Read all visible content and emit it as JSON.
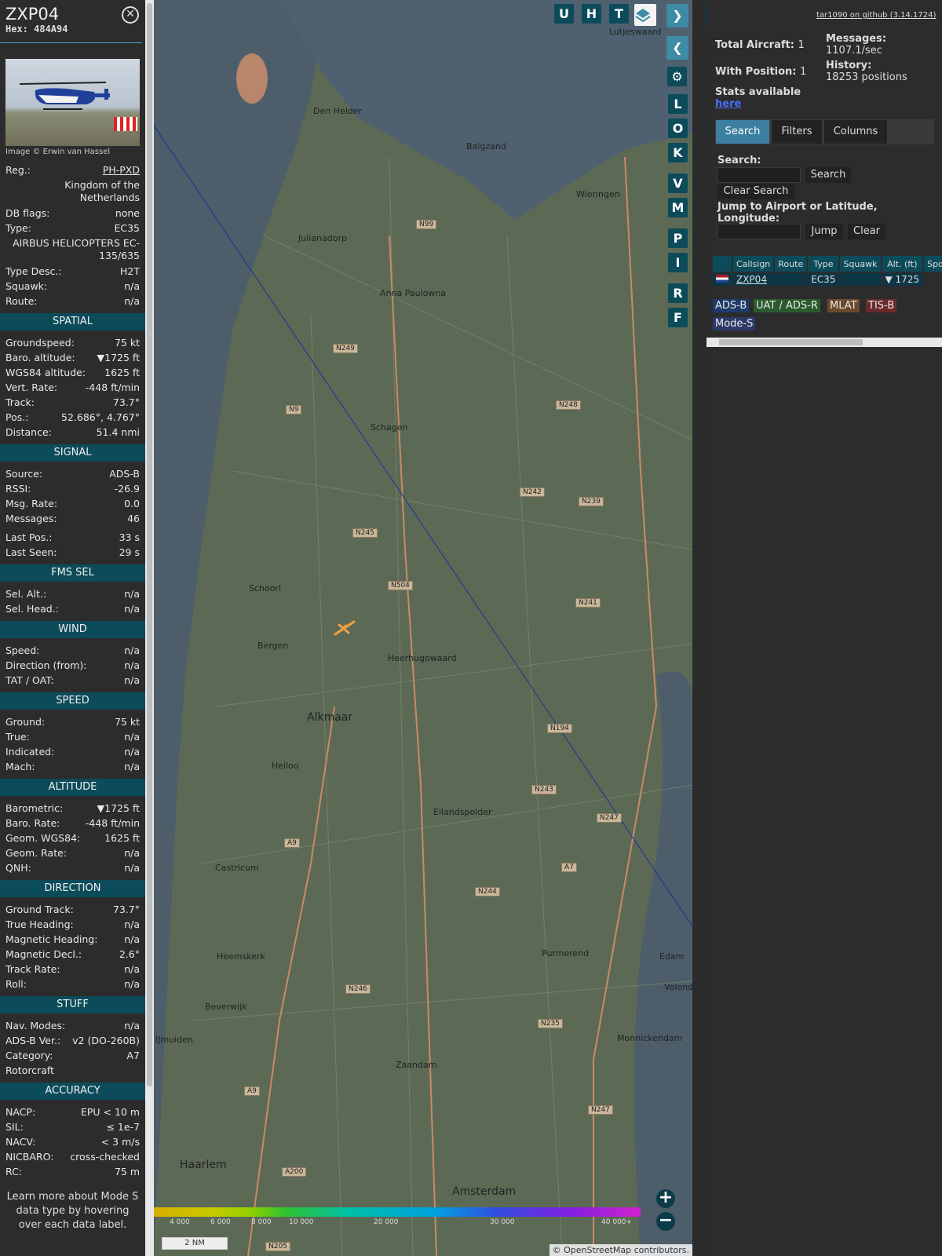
{
  "info": {
    "callsign": "ZXP04",
    "hex": "Hex: 484A94",
    "photo_credit": "Image © Erwin van Hassel",
    "basic": [
      {
        "k": "Reg.:",
        "v": "PH-PXD"
      },
      {
        "k": "",
        "v": "Kingdom of the Netherlands"
      },
      {
        "k": "DB flags:",
        "v": "none"
      },
      {
        "k": "Type:",
        "v": "EC35"
      },
      {
        "k": "",
        "v": "AIRBUS HELICOPTERS EC-135/635"
      },
      {
        "k": "Type Desc.:",
        "v": "H2T"
      },
      {
        "k": "Squawk:",
        "v": "n/a"
      },
      {
        "k": "Route:",
        "v": "n/a"
      }
    ],
    "sections": [
      {
        "title": "SPATIAL",
        "rows": [
          {
            "k": "Groundspeed:",
            "v": "75 kt"
          },
          {
            "k": "Baro. altitude:",
            "v": "▼1725 ft"
          },
          {
            "k": "WGS84 altitude:",
            "v": "1625 ft"
          },
          {
            "k": "Vert. Rate:",
            "v": "-448 ft/min"
          },
          {
            "k": "Track:",
            "v": "73.7°"
          },
          {
            "k": "Pos.:",
            "v": "52.686°, 4.767°"
          },
          {
            "k": "Distance:",
            "v": "51.4 nmi"
          }
        ]
      },
      {
        "title": "SIGNAL",
        "rows": [
          {
            "k": "Source:",
            "v": "ADS-B"
          },
          {
            "k": "RSSI:",
            "v": "-26.9"
          },
          {
            "k": "Msg. Rate:",
            "v": "0.0"
          },
          {
            "k": "Messages:",
            "v": "46"
          },
          {
            "k": "Last Pos.:",
            "v": "33 s"
          },
          {
            "k": "Last Seen:",
            "v": "29 s"
          }
        ]
      },
      {
        "title": "FMS SEL",
        "rows": [
          {
            "k": "Sel. Alt.:",
            "v": "n/a"
          },
          {
            "k": "Sel. Head.:",
            "v": "n/a"
          }
        ]
      },
      {
        "title": "WIND",
        "rows": [
          {
            "k": "Speed:",
            "v": "n/a"
          },
          {
            "k": "Direction (from):",
            "v": "n/a"
          },
          {
            "k": "TAT / OAT:",
            "v": "n/a"
          }
        ]
      },
      {
        "title": "SPEED",
        "rows": [
          {
            "k": "Ground:",
            "v": "75 kt"
          },
          {
            "k": "True:",
            "v": "n/a"
          },
          {
            "k": "Indicated:",
            "v": "n/a"
          },
          {
            "k": "Mach:",
            "v": "n/a"
          }
        ]
      },
      {
        "title": "ALTITUDE",
        "rows": [
          {
            "k": "Barometric:",
            "v": "▼1725 ft"
          },
          {
            "k": "Baro. Rate:",
            "v": "-448 ft/min"
          },
          {
            "k": "Geom. WGS84:",
            "v": "1625 ft"
          },
          {
            "k": "Geom. Rate:",
            "v": "n/a"
          },
          {
            "k": "QNH:",
            "v": "n/a"
          }
        ]
      },
      {
        "title": "DIRECTION",
        "rows": [
          {
            "k": "Ground Track:",
            "v": "73.7°"
          },
          {
            "k": "True Heading:",
            "v": "n/a"
          },
          {
            "k": "Magnetic Heading:",
            "v": "n/a"
          },
          {
            "k": "Magnetic Decl.:",
            "v": "2.6°"
          },
          {
            "k": "Track Rate:",
            "v": "n/a"
          },
          {
            "k": "Roll:",
            "v": "n/a"
          }
        ]
      },
      {
        "title": "STUFF",
        "rows": [
          {
            "k": "Nav. Modes:",
            "v": "n/a"
          },
          {
            "k": "ADS-B Ver.:",
            "v": "v2 (DO-260B)"
          },
          {
            "k": "Category:",
            "v": "A7"
          },
          {
            "k": "Rotorcraft",
            "v": ""
          }
        ]
      },
      {
        "title": "ACCURACY",
        "rows": [
          {
            "k": "NACP:",
            "v": "EPU < 10 m"
          },
          {
            "k": "SIL:",
            "v": "≤ 1e-7"
          },
          {
            "k": "NACV:",
            "v": "< 3 m/s"
          },
          {
            "k": "NICBARO:",
            "v": "cross-checked"
          },
          {
            "k": "RC:",
            "v": "75 m"
          }
        ]
      }
    ],
    "footer_note": "Learn more about Mode S data type by hovering over each data label."
  },
  "map": {
    "places": [
      {
        "name": "Den Helder",
        "big": false
      },
      {
        "name": "Julianadorp",
        "big": false
      },
      {
        "name": "Anna Paulowna",
        "big": false
      },
      {
        "name": "Wieringen",
        "big": false
      },
      {
        "name": "Schagen",
        "big": false
      },
      {
        "name": "Schoorl",
        "big": false
      },
      {
        "name": "Bergen",
        "big": false
      },
      {
        "name": "Heerhugowaard",
        "big": false
      },
      {
        "name": "Alkmaar",
        "big": true
      },
      {
        "name": "Heiloo",
        "big": false
      },
      {
        "name": "Castricum",
        "big": false
      },
      {
        "name": "Heemskerk",
        "big": false
      },
      {
        "name": "Beverwijk",
        "big": false
      },
      {
        "name": "IJmuiden",
        "big": false
      },
      {
        "name": "Zaandam",
        "big": false
      },
      {
        "name": "Purmerend",
        "big": false
      },
      {
        "name": "Edam",
        "big": false
      },
      {
        "name": "Volendam",
        "big": false
      },
      {
        "name": "Monnickendam",
        "big": false
      },
      {
        "name": "Haarlem",
        "big": true
      },
      {
        "name": "Amsterdam",
        "big": true
      },
      {
        "name": "Balgzand",
        "big": false
      },
      {
        "name": "Lutjeswaard",
        "big": false
      },
      {
        "name": "Eilandspolder",
        "big": false
      }
    ],
    "roads": [
      "N99",
      "N249",
      "N9",
      "N248",
      "N242",
      "N239",
      "N245",
      "N504",
      "N241",
      "N194",
      "N243",
      "N247",
      "N244",
      "A9",
      "A7",
      "N246",
      "N235",
      "N247",
      "A9",
      "A200",
      "N205"
    ],
    "controls": [
      "U",
      "H",
      "T",
      "L",
      "O",
      "K",
      "V",
      "M",
      "P",
      "I",
      "R",
      "F"
    ],
    "colorbar_ticks": [
      "4 000",
      "6 000",
      "8 000",
      "10 000",
      "20 000",
      "30 000",
      "40 000+"
    ],
    "scale_label": "2 NM",
    "attribution": "© OpenStreetMap contributors."
  },
  "right": {
    "github": "tar1090 on github (3.14.1724)",
    "total_aircraft_label": "Total Aircraft:",
    "total_aircraft": "1",
    "messages_label": "Messages:",
    "messages": "1107.1/sec",
    "with_position_label": "With Position:",
    "with_position": "1",
    "history_label": "History:",
    "history": "18253 positions",
    "stats_label": "Stats available",
    "stats_link": "here",
    "tabs": [
      "Search",
      "Filters",
      "Columns"
    ],
    "search_label": "Search:",
    "search_btn": "Search",
    "clear_search_btn": "Clear Search",
    "jump_label": "Jump to Airport or Latitude, Longitude:",
    "jump_btn": "Jump",
    "clear_btn": "Clear",
    "columns": [
      "",
      "Callsign",
      "Route",
      "Type",
      "Squawk",
      "Alt. (ft)",
      "Spd"
    ],
    "rows": [
      {
        "flag": "NL",
        "callsign": "ZXP04",
        "route": "",
        "type": "EC35",
        "squawk": "",
        "alt": "▼ 1725"
      }
    ],
    "sources": [
      {
        "label": "ADS-B",
        "color": "#1e3a6a"
      },
      {
        "label": "UAT / ADS-R",
        "color": "#2a5a2e"
      },
      {
        "label": "MLAT",
        "color": "#6a4a2a"
      },
      {
        "label": "TIS-B",
        "color": "#6a2a2a"
      },
      {
        "label": "Mode-S",
        "color": "#2e3a6a"
      }
    ]
  }
}
